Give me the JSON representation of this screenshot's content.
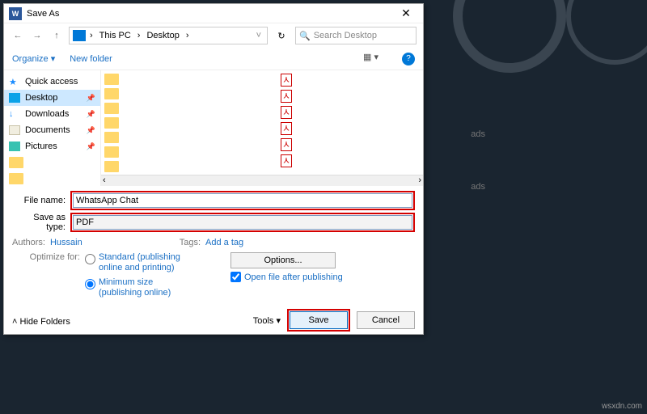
{
  "titlebar": {
    "title": "Save As",
    "close": "✕"
  },
  "nav": {
    "back": "←",
    "fwd": "→",
    "up": "↑",
    "chev": "›",
    "refresh": "↻",
    "search_icon": "🔍"
  },
  "breadcrumb": {
    "root": "This PC",
    "loc": "Desktop"
  },
  "search": {
    "placeholder": "Search Desktop"
  },
  "toolbar": {
    "organize": "Organize ▾",
    "newfolder": "New folder",
    "help": "?"
  },
  "sidebar": {
    "items": [
      {
        "label": "Quick access"
      },
      {
        "label": "Desktop"
      },
      {
        "label": "Downloads"
      },
      {
        "label": "Documents"
      },
      {
        "label": "Pictures"
      }
    ]
  },
  "fields": {
    "filename_label": "File name:",
    "filename_value": "WhatsApp Chat",
    "type_label": "Save as type:",
    "type_value": "PDF"
  },
  "meta": {
    "authors_label": "Authors:",
    "authors_value": "Hussain",
    "tags_label": "Tags:",
    "tags_value": "Add a tag"
  },
  "optimize": {
    "label": "Optimize for:",
    "standard": "Standard (publishing online and printing)",
    "minimum": "Minimum size (publishing online)",
    "options": "Options...",
    "openafter": "Open file after publishing"
  },
  "footer": {
    "hide": "Hide Folders",
    "tools": "Tools   ▾",
    "save": "Save",
    "cancel": "Cancel"
  },
  "bg": {
    "t1": "ads",
    "t2": "ads"
  },
  "watermark": "wsxdn.com"
}
